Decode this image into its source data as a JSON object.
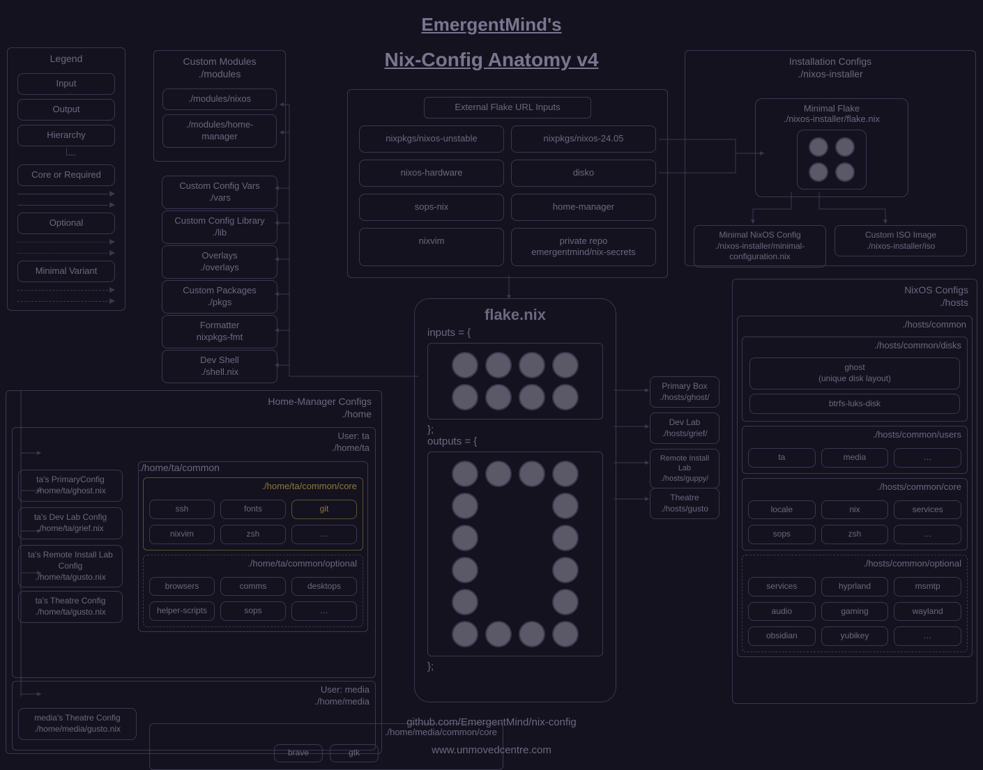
{
  "title1": "EmergentMind's",
  "title2": "Nix-Config Anatomy v4",
  "legend": {
    "head": "Legend",
    "input": "Input",
    "output": "Output",
    "hierarchy": "Hierarchy",
    "core": "Core or Required",
    "optional": "Optional",
    "minimal": "Minimal Variant"
  },
  "custom_modules": {
    "head": "Custom Modules\n./modules",
    "items": [
      "./modules/nixos",
      "./modules/home-manager"
    ]
  },
  "extras": {
    "vars": "Custom Config Vars\n./vars",
    "lib": "Custom Config Library\n./lib",
    "overlays": "Overlays\n./overlays",
    "pkgs": "Custom Packages\n./pkgs",
    "formatter": "Formatter\nnixpkgs-fmt",
    "shell": "Dev Shell\n./shell.nix"
  },
  "external": {
    "head": "External Flake URL Inputs",
    "items": [
      "nixpkgs/nixos-unstable",
      "nixpkgs/nixos-24.05",
      "nixos-hardware",
      "disko",
      "sops-nix",
      "home-manager",
      "nixvim",
      "private repo\nemergentmind/nix-secrets"
    ]
  },
  "install": {
    "head": "Installation Configs\n./nixos-installer",
    "minflake": "Minimal Flake\n./nixos-installer/flake.nix",
    "mincfg": "Minimal NixOS Config\n./nixos-installer/minimal-configuration.nix",
    "iso": "Custom ISO Image\n./nixos-installer/iso"
  },
  "flake": {
    "head": "flake.nix",
    "inputs_open": "inputs = {",
    "outputs_open": "outputs = {",
    "close": "};"
  },
  "host_boxes": {
    "primary": "Primary Box\n./hosts/ghost/",
    "dev": "Dev Lab\n./hosts/grief/",
    "remote": "Remote Install Lab\n./hosts/guppy/",
    "theatre": "Theatre\n./hosts/gusto"
  },
  "hosts": {
    "head": "NixOS Configs\n./hosts",
    "common": "./hosts/common",
    "disks": {
      "head": "./hosts/common/disks",
      "ghost": "ghost\n(unique disk layout)",
      "btrfs": "btrfs-luks-disk"
    },
    "users": {
      "head": "./hosts/common/users",
      "items": [
        "ta",
        "media",
        "…"
      ]
    },
    "core": {
      "head": "./hosts/common/core",
      "items": [
        "locale",
        "nix",
        "services",
        "sops",
        "zsh",
        "…"
      ]
    },
    "optional": {
      "head": "./hosts/common/optional",
      "items": [
        "services",
        "hyprland",
        "msmtp",
        "audio",
        "gaming",
        "wayland",
        "obsidian",
        "yubikey",
        "…"
      ]
    }
  },
  "home": {
    "head": "Home-Manager Configs\n./home",
    "user_ta": "User: ta\n./home/ta",
    "user_media": "User: media\n./home/media",
    "ta_cfgs": {
      "primary": "ta's PrimaryConfig\n./home/ta/ghost.nix",
      "dev": "ta's Dev Lab Config\n./home/ta/grief.nix",
      "remote": "ta's Remote Install Lab Config\n./home/ta/gusto.nix",
      "theatre": "ta's Theatre Config\n./home/ta/gusto.nix"
    },
    "ta_common": "./home/ta/common",
    "ta_core": {
      "head": "./home/ta/common/core",
      "items": [
        "ssh",
        "fonts",
        "git",
        "nixvim",
        "zsh",
        "…"
      ]
    },
    "ta_optional": {
      "head": "./home/ta/common/optional",
      "items": [
        "browsers",
        "comms",
        "desktops",
        "helper-scripts",
        "sops",
        "…"
      ]
    },
    "media_core": {
      "head": "./home/media/common/core",
      "items": [
        "brave",
        "gtk"
      ]
    },
    "media_cfg": "media's Theatre Config\n./home/media/gusto.nix"
  },
  "footer": {
    "gh": "github.com/EmergentMind/nix-config",
    "site": "www.unmovedcentre.com"
  }
}
